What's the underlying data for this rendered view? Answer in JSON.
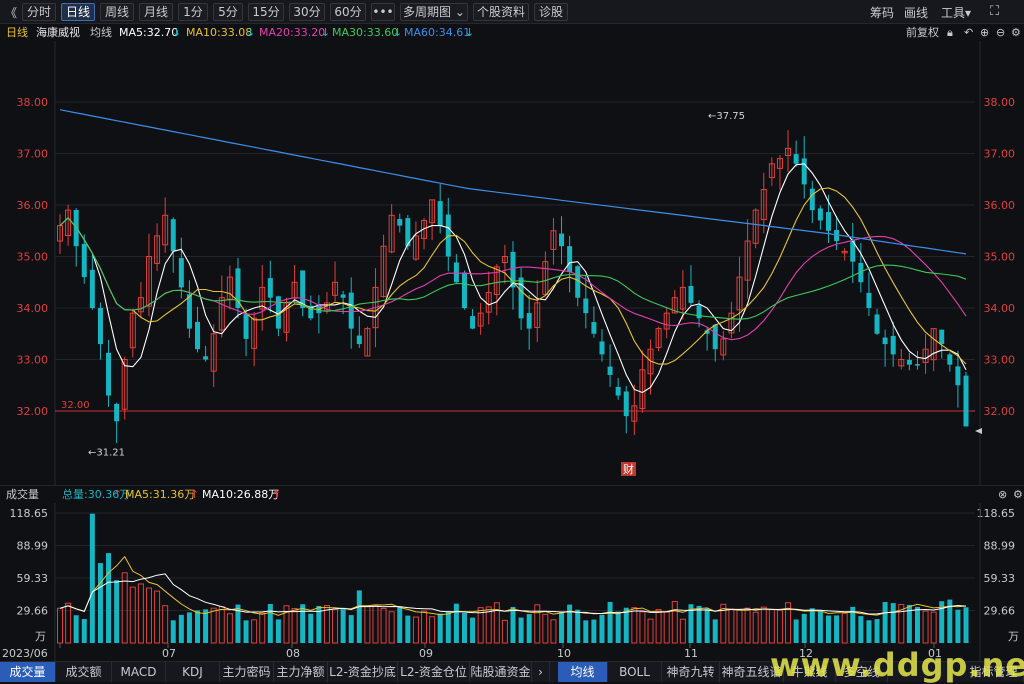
{
  "toolbar": {
    "back": "《",
    "periods": [
      "分时",
      "日线",
      "周线",
      "月线",
      "1分",
      "5分",
      "15分",
      "30分",
      "60分"
    ],
    "more": "•••",
    "multi": "多周期图",
    "profile": "个股资料",
    "diagnose": "诊股",
    "right": [
      "筹码",
      "画线",
      "工具▾"
    ],
    "fullscreen": "⛶"
  },
  "legend": {
    "period": "日线",
    "stock": "海康威视",
    "avg": "均线",
    "ma5": "MA5:32.70",
    "ma10": "MA10:33.08",
    "ma20": "MA20:33.20",
    "ma30": "MA30:33.60",
    "ma60": "MA60:34.61",
    "restore": "前复权"
  },
  "colors": {
    "up": "#e0403a",
    "down": "#16b5c2",
    "ma5": "#ffffff",
    "ma10": "#e8c22a",
    "ma20": "#e03fb0",
    "ma30": "#3cc85a",
    "ma60": "#3b8fe8",
    "ref": "#c8323a",
    "axis": "#e03e3e"
  },
  "price_axis": [
    "38.00",
    "37.00",
    "36.00",
    "35.00",
    "34.00",
    "33.00",
    "32.00"
  ],
  "annotations": {
    "high": "37.75",
    "low": "31.21",
    "ref": "32.00",
    "fin": "财"
  },
  "volume_legend": {
    "label": "成交量",
    "total": "总量:30.36万",
    "ma5": "MA5:31.36万",
    "ma10": "MA10:26.88万"
  },
  "volume_axis": [
    "118.65",
    "88.99",
    "59.33",
    "29.66",
    "万"
  ],
  "dates": [
    "2023/06",
    "07",
    "08",
    "09",
    "10",
    "11",
    "12",
    "01"
  ],
  "bottom_tabs": [
    "成交量",
    "成交额",
    "MACD",
    "KDJ",
    "主力密码",
    "主力净额",
    "L2-资金抄底",
    "L2-资金仓位",
    "陆股通资金"
  ],
  "bottom_right_tabs": [
    "均线",
    "BOLL",
    "神奇九转",
    "神奇五线谱",
    "牛熊线",
    "多空线",
    "指标管理"
  ],
  "watermark": "www.ddgp.net",
  "chart_data": {
    "type": "candlestick",
    "series": [
      {
        "name": "日线",
        "values": [
          35.6,
          35.9,
          35.2,
          34.6,
          34.0,
          33.3,
          32.3,
          31.8,
          33.0,
          33.9,
          34.2,
          35.0,
          35.4,
          35.8,
          35.1,
          34.4,
          33.6,
          33.2,
          33.0,
          33.5,
          34.2,
          34.6,
          34.0,
          33.4,
          33.8,
          34.4,
          34.2,
          33.6,
          34.1,
          34.5,
          34.0,
          33.8,
          33.9,
          34.1,
          34.5,
          34.2,
          33.6,
          33.3,
          33.6,
          34.4,
          35.2,
          35.8,
          35.6,
          35.2,
          35.4,
          35.7,
          36.1,
          35.6,
          35.0,
          34.5,
          34.0,
          33.6,
          33.9,
          34.3,
          34.8,
          35.0,
          34.4,
          33.8,
          33.6,
          34.1,
          34.9,
          35.5,
          35.2,
          34.7,
          34.2,
          33.9,
          33.5,
          33.1,
          32.7,
          32.3,
          31.9,
          32.1,
          32.8,
          33.2,
          33.6,
          33.9,
          34.2,
          34.4,
          34.1,
          33.8,
          33.5,
          33.2,
          33.4,
          33.9,
          34.6,
          35.3,
          35.9,
          36.3,
          36.8,
          36.9,
          37.1,
          36.8,
          36.4,
          35.9,
          35.7,
          35.5,
          35.3,
          35.1,
          34.9,
          34.5,
          34.0,
          33.5,
          33.3,
          33.1,
          33.0,
          32.9,
          32.9,
          33.2,
          33.6,
          33.3,
          32.9,
          32.5,
          31.7
        ]
      }
    ],
    "price_range": [
      31.21,
      37.75
    ],
    "ma": {
      "MA5": 32.7,
      "MA10": 33.08,
      "MA20": 33.2,
      "MA30": 33.6,
      "MA60": 34.61
    },
    "volume": {
      "total": 30.36,
      "ma5": 31.36,
      "ma10": 26.88,
      "axis_max": 118.65,
      "unit": "万"
    }
  }
}
